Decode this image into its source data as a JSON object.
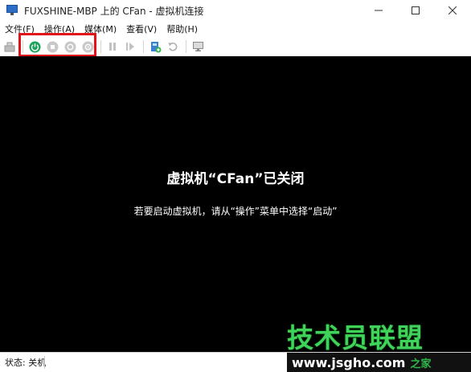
{
  "window": {
    "title": "FUXSHINE-MBP 上的 CFan - 虚拟机连接",
    "controls": [
      "minimize-icon",
      "maximize-icon",
      "close-icon"
    ]
  },
  "menu": [
    {
      "label": "文件(F)"
    },
    {
      "label": "操作(A)"
    },
    {
      "label": "媒体(M)"
    },
    {
      "label": "查看(V)"
    },
    {
      "label": "帮助(H)"
    }
  ],
  "toolbar": {
    "icons": [
      "ctrl-alt-del-icon",
      "start-icon",
      "turn-off-icon",
      "shut-down-icon",
      "save-icon",
      "pause-icon",
      "resume-icon",
      "checkpoint-icon",
      "revert-icon",
      "enhanced-session-icon"
    ],
    "colors": {
      "start": "#1aa35a",
      "highlight": "#e2121b"
    }
  },
  "vm": {
    "title": "虚拟机“CFan”已关闭",
    "hint": "若要启动虚拟机，请从“操作”菜单中选择“启动”"
  },
  "status": {
    "text": "状态: 关机"
  },
  "watermark": {
    "big": "技术员联盟",
    "url": "www.jsgho.com",
    "tail": "之家"
  }
}
